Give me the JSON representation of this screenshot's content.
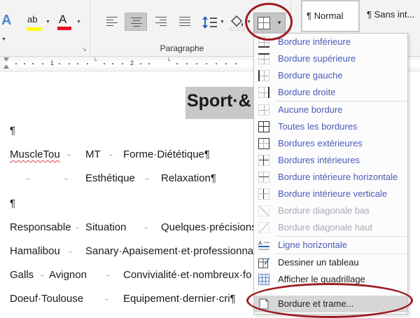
{
  "ribbon": {
    "font_effect_icon": "A",
    "highlight_icon_text": "ab",
    "font_color_icon_text": "A",
    "group_label": "Paragraphe",
    "styles": {
      "normal": "¶ Normal",
      "sans_interligne": "¶ Sans int..."
    },
    "colors": {
      "highlight": "#ffff00",
      "font_color": "#e81123",
      "annotation": "#9c1d24"
    }
  },
  "ruler": {
    "numbers": [
      "1",
      "2"
    ]
  },
  "document": {
    "title": "Sport·&",
    "lines": [
      [
        "¶"
      ],
      [
        "MuscleTou",
        "MT",
        "Forme·Diététique¶"
      ],
      [
        "Esthétique",
        "Relaxation¶"
      ],
      [
        "¶"
      ],
      [
        "Responsable",
        "Situation",
        "Quelques·précisions"
      ],
      [
        "Hamalibou",
        "Sanary·Apaisement·et·professionna"
      ],
      [
        "Galls",
        "Avignon",
        "Convivialité·et·nombreux·fo"
      ],
      [
        "Doeuf·Toulouse",
        "Equipement·dernier·cri¶"
      ]
    ]
  },
  "menu": {
    "items": [
      {
        "label": "Bordure inférieure",
        "icon": "border-bottom-icon"
      },
      {
        "label": "Bordure supérieure",
        "icon": "border-top-icon"
      },
      {
        "label": "Bordure gauche",
        "icon": "border-left-icon"
      },
      {
        "label": "Bordure droite",
        "icon": "border-right-icon"
      },
      {
        "label": "Aucune bordure",
        "icon": "no-border-icon"
      },
      {
        "label": "Toutes les bordures",
        "icon": "all-borders-icon"
      },
      {
        "label": "Bordures extérieures",
        "icon": "outside-borders-icon"
      },
      {
        "label": "Bordures intérieures",
        "icon": "inside-borders-icon"
      },
      {
        "label": "Bordure intérieure horizontale",
        "icon": "inside-horizontal-border-icon"
      },
      {
        "label": "Bordure intérieure verticale",
        "icon": "inside-vertical-border-icon"
      },
      {
        "label": "Bordure diagonale bas",
        "icon": "diagonal-down-border-icon",
        "disabled": true
      },
      {
        "label": "Bordure diagonale haut",
        "icon": "diagonal-up-border-icon",
        "disabled": true
      },
      {
        "label": "Ligne horizontale",
        "icon": "horizontal-line-icon"
      },
      {
        "label": "Dessiner un tableau",
        "icon": "draw-table-icon"
      },
      {
        "label": "Afficher le quadrillage",
        "icon": "gridlines-icon"
      },
      {
        "label": "Bordure et trame...",
        "icon": "borders-shading-icon",
        "selected": true
      }
    ]
  }
}
